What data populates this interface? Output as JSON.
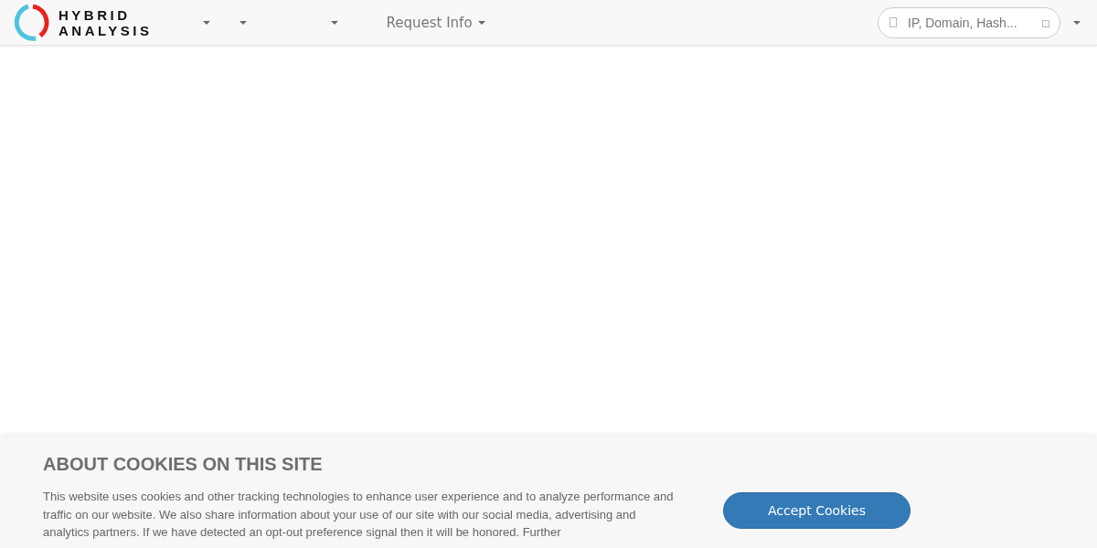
{
  "navbar": {
    "logo": {
      "line_1": "HYBRID",
      "line_2": "ANALYSIS"
    },
    "menus": [
      {
        "kind": "caret"
      },
      {
        "kind": "caret"
      },
      {
        "kind": "caret"
      },
      {
        "kind": "text",
        "label": "Request Info"
      }
    ],
    "search": {
      "placeholder": "IP, Domain, Hash..."
    }
  },
  "cookie_banner": {
    "title": "ABOUT COOKIES ON THIS SITE",
    "text": "This website uses cookies and other tracking technologies to enhance user experience and to analyze performance and traffic on our website. We also share information about your use of our site with our social media, advertising and analytics partners. If we have detected an opt-out preference signal then it will be honored. Further",
    "button": "Accept Cookies"
  }
}
